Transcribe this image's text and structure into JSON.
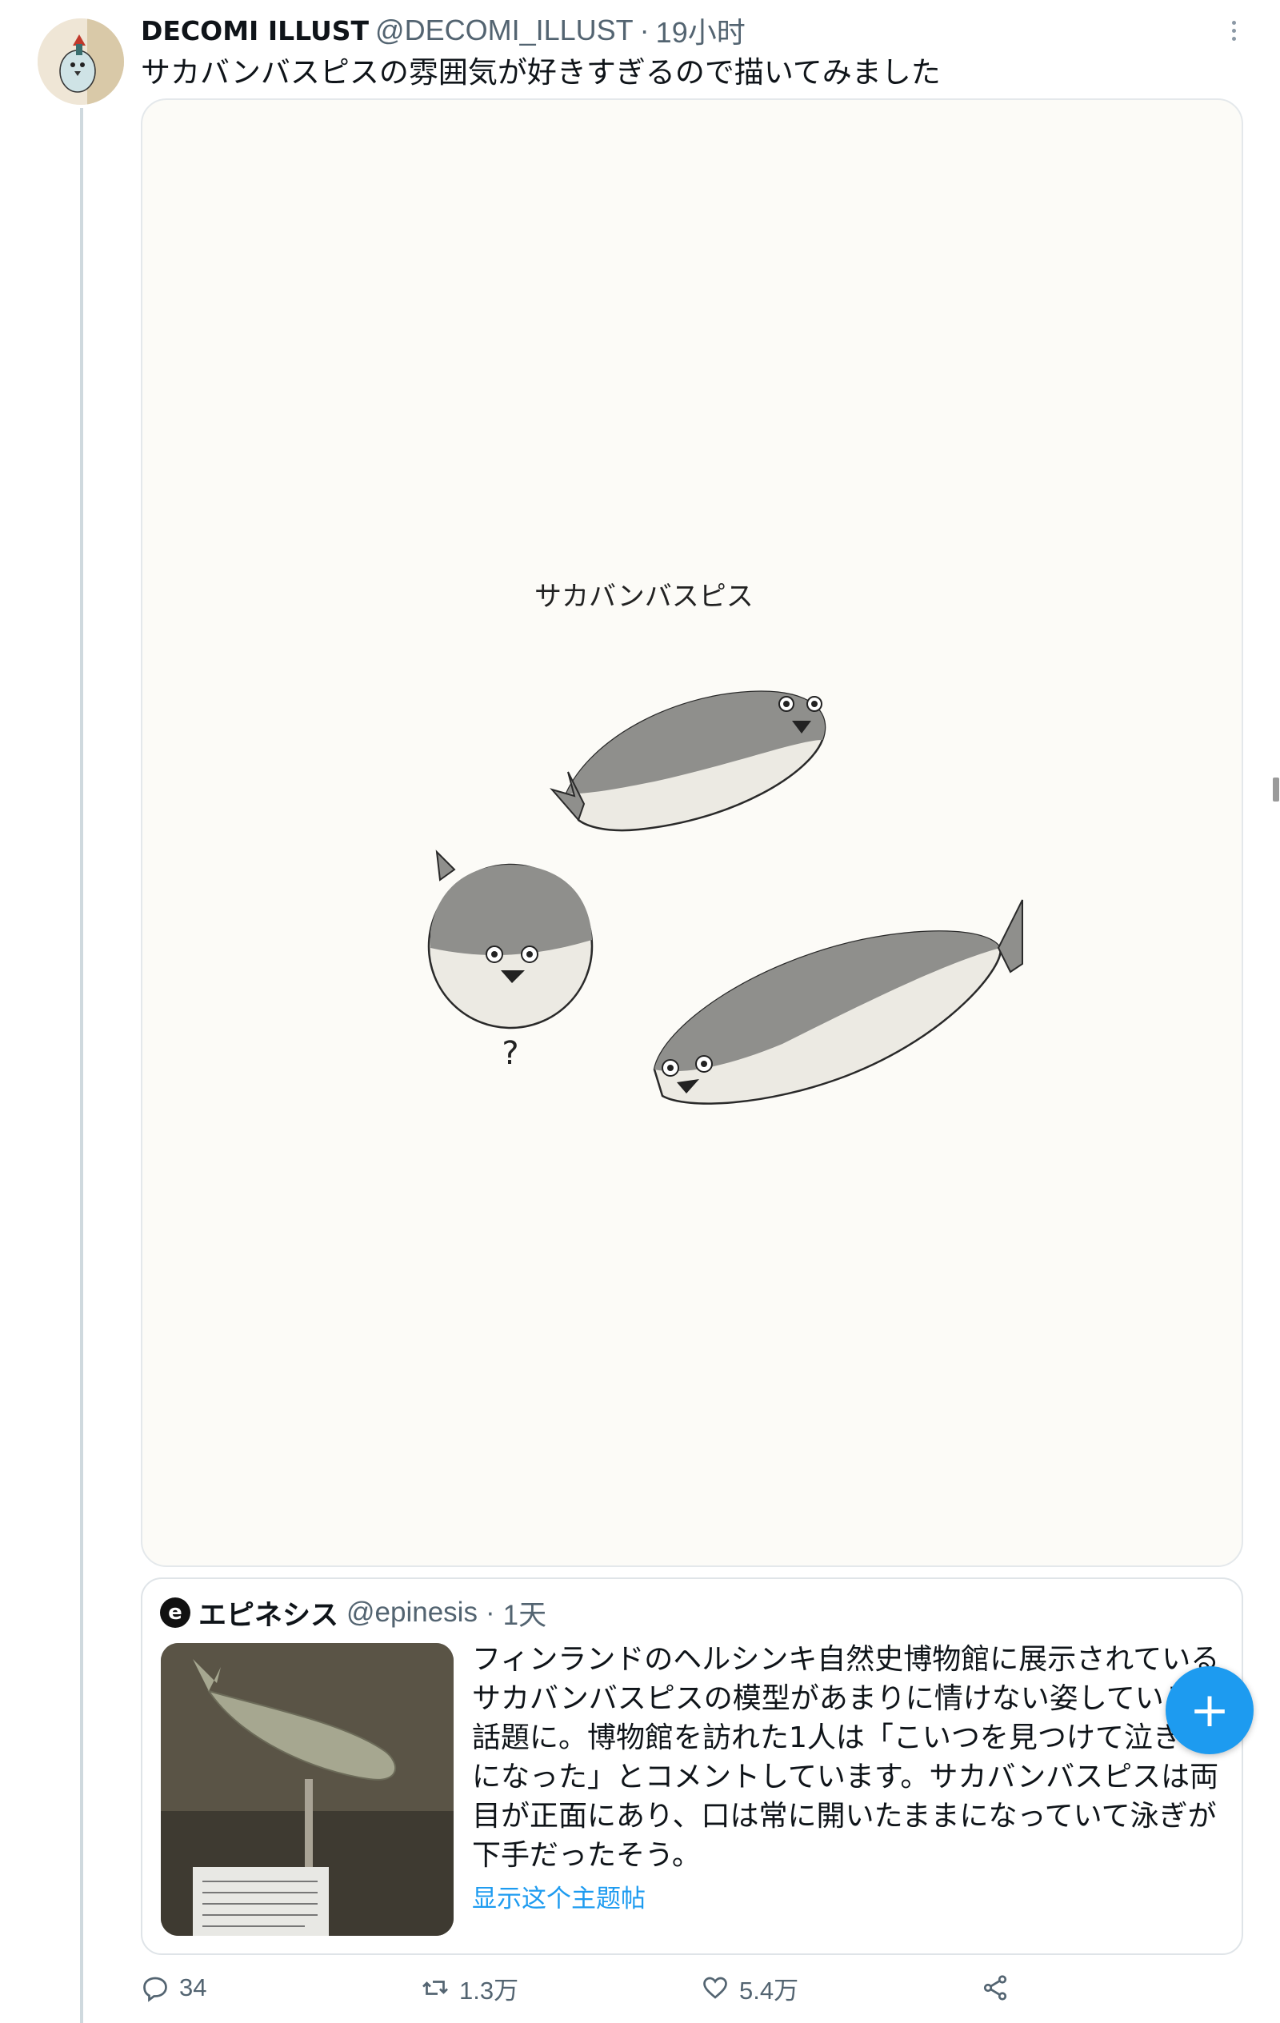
{
  "tweet": {
    "author_name": "DECOMI ILLUST",
    "handle": "@DECOMI_ILLUST",
    "time": "19小时",
    "text": "サカバンバスピスの雰囲気が好きすぎるので描いてみました",
    "image_caption": "サカバンバスピス",
    "image_mark": "?"
  },
  "quote": {
    "logo_letter": "e",
    "author_name": "エピネシス",
    "handle": "@epinesis",
    "time": "1天",
    "text": "フィンランドのヘルシンキ自然史博物館に展示されているサカバンバスピスの模型があまりに情けない姿していると話題に。博物館を訪れた1人は「こいつを見つけて泣きそうになった」とコメントしています。サカバンバスピスは両目が正面にあり、口は常に開いたままになっていて泳ぎが下手だったそう。",
    "show_thread": "显示这个主题帖"
  },
  "actions": {
    "replies": "34",
    "retweets": "1.3万",
    "likes": "5.4万"
  },
  "fab_label": "+",
  "colors": {
    "accent": "#1d9bf0",
    "secondary_text": "#536471",
    "border": "#e4e8eb",
    "illustration_bg": "#fcfbf7"
  },
  "icons": [
    "more-icon",
    "reply-icon",
    "retweet-icon",
    "like-icon",
    "share-icon",
    "compose-plus-icon"
  ]
}
